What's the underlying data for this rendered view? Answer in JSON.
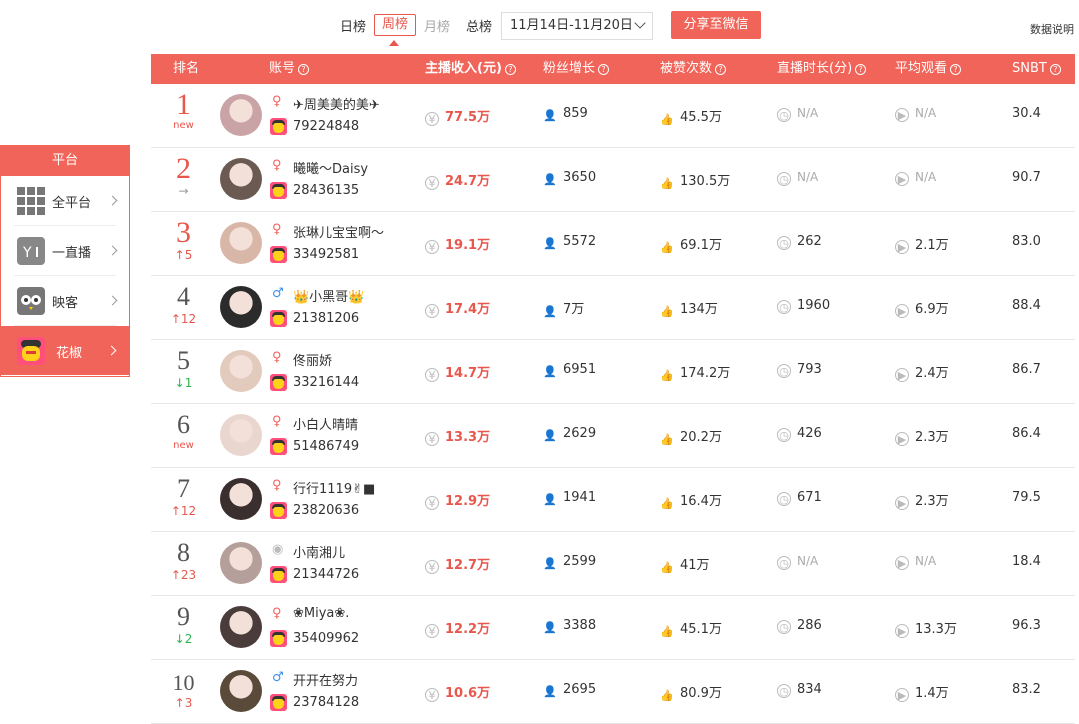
{
  "tabs": [
    {
      "label": "日榜",
      "state": "normal"
    },
    {
      "label": "周榜",
      "state": "active"
    },
    {
      "label": "月榜",
      "state": "muted"
    },
    {
      "label": "总榜",
      "state": "normal"
    }
  ],
  "date_range": "11月14日-11月20日",
  "share_button": "分享至微信",
  "data_note": "数据说明",
  "columns": {
    "rank": "排名",
    "account": "账号",
    "income": "主播收入(元)",
    "fans": "粉丝增长",
    "likes": "被赞次数",
    "duration": "直播时长(分)",
    "avg_view": "平均观看",
    "snbt": "SNBT"
  },
  "platform_panel": {
    "title": "平台",
    "items": [
      {
        "label": "全平台",
        "icon": "grid-icon"
      },
      {
        "label": "一直播",
        "icon": "yizhibo-icon"
      },
      {
        "label": "映客",
        "icon": "owl-icon"
      },
      {
        "label": "花椒",
        "icon": "huajiao-icon",
        "active": true
      }
    ]
  },
  "rows": [
    {
      "rank": "1",
      "change": "new",
      "change_type": "new",
      "gender": "f",
      "name": "✈周美美的美✈",
      "uid": "79224848",
      "income": "77.5万",
      "fans": "859",
      "likes": "45.5万",
      "duration": "N/A",
      "avg_view": "N/A",
      "snbt": "30.4"
    },
    {
      "rank": "2",
      "change": "→",
      "change_type": "same",
      "gender": "f",
      "name": "曦曦～Daisy",
      "uid": "28436135",
      "income": "24.7万",
      "fans": "3650",
      "likes": "130.5万",
      "duration": "N/A",
      "avg_view": "N/A",
      "snbt": "90.7"
    },
    {
      "rank": "3",
      "change": "↑5",
      "change_type": "up",
      "gender": "f",
      "name": "张琳儿宝宝啊～",
      "uid": "33492581",
      "income": "19.1万",
      "fans": "5572",
      "likes": "69.1万",
      "duration": "262",
      "avg_view": "2.1万",
      "snbt": "83.0"
    },
    {
      "rank": "4",
      "change": "↑12",
      "change_type": "up",
      "gender": "m",
      "name": "👑小黑哥👑",
      "uid": "21381206",
      "income": "17.4万",
      "fans": "7万",
      "likes": "134万",
      "duration": "1960",
      "avg_view": "6.9万",
      "snbt": "88.4"
    },
    {
      "rank": "5",
      "change": "↓1",
      "change_type": "down",
      "gender": "f",
      "name": "佟丽娇",
      "uid": "33216144",
      "income": "14.7万",
      "fans": "6951",
      "likes": "174.2万",
      "duration": "793",
      "avg_view": "2.4万",
      "snbt": "86.7"
    },
    {
      "rank": "6",
      "change": "new",
      "change_type": "new",
      "gender": "f",
      "name": "小白人晴晴",
      "uid": "51486749",
      "income": "13.3万",
      "fans": "2629",
      "likes": "20.2万",
      "duration": "426",
      "avg_view": "2.3万",
      "snbt": "86.4"
    },
    {
      "rank": "7",
      "change": "↑12",
      "change_type": "up",
      "gender": "f",
      "name": "行行1119✌■",
      "uid": "23820636",
      "income": "12.9万",
      "fans": "1941",
      "likes": "16.4万",
      "duration": "671",
      "avg_view": "2.3万",
      "snbt": "79.5"
    },
    {
      "rank": "8",
      "change": "↑23",
      "change_type": "up",
      "gender": "u",
      "name": "小南湘儿",
      "uid": "21344726",
      "income": "12.7万",
      "fans": "2599",
      "likes": "41万",
      "duration": "N/A",
      "avg_view": "N/A",
      "snbt": "18.4"
    },
    {
      "rank": "9",
      "change": "↓2",
      "change_type": "down",
      "gender": "f",
      "name": "❀Miya❀.",
      "uid": "35409962",
      "income": "12.2万",
      "fans": "3388",
      "likes": "45.1万",
      "duration": "286",
      "avg_view": "13.3万",
      "snbt": "96.3"
    },
    {
      "rank": "10",
      "change": "↑3",
      "change_type": "up",
      "gender": "m",
      "name": "开开在努力",
      "uid": "23784128",
      "income": "10.6万",
      "fans": "2695",
      "likes": "80.9万",
      "duration": "834",
      "avg_view": "1.4万",
      "snbt": "83.2"
    }
  ],
  "colors": {
    "accent": "#f0645a",
    "up": "#e8574c",
    "down": "#2bb24c"
  }
}
